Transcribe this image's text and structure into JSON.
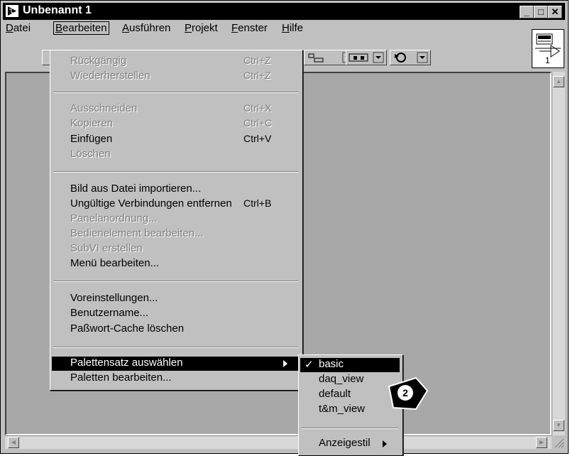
{
  "window": {
    "title": "Unbenannt 1"
  },
  "window_buttons": {
    "minimize": "_",
    "maximize": "□",
    "close": "✕"
  },
  "menubar": {
    "items": [
      {
        "label": "Datei",
        "u": "D",
        "rest": "atei"
      },
      {
        "label": "Bearbeiten",
        "u": "B",
        "rest": "earbeiten"
      },
      {
        "label": "Ausführen",
        "u": "A",
        "rest": "usführen"
      },
      {
        "label": "Projekt",
        "u": "P",
        "rest": "rojekt"
      },
      {
        "label": "Fenster",
        "u": "F",
        "rest": "enster"
      },
      {
        "label": "Hilfe",
        "u": "H",
        "rest": "ilfe"
      }
    ]
  },
  "vi_icon": {
    "connector_number": "1"
  },
  "edit_menu": {
    "items": [
      {
        "label": "Rückgängig",
        "shortcut": "Ctrl+Z",
        "enabled": false
      },
      {
        "label": "Wiederherstellen",
        "shortcut": "Ctrl+Z",
        "enabled": false
      },
      {
        "label": "Ausschneiden",
        "shortcut": "Ctrl+X",
        "enabled": false
      },
      {
        "label": "Kopieren",
        "shortcut": "Ctrl+C",
        "enabled": false
      },
      {
        "label": "Einfügen",
        "shortcut": "Ctrl+V",
        "enabled": true
      },
      {
        "label": "Löschen",
        "shortcut": "",
        "enabled": false
      },
      {
        "label": "Bild aus Datei importieren...",
        "shortcut": "",
        "enabled": true
      },
      {
        "label": "Ungültige Verbindungen entfernen",
        "shortcut": "Ctrl+B",
        "enabled": true
      },
      {
        "label": "Panelanordnung...",
        "shortcut": "",
        "enabled": false
      },
      {
        "label": "Bedienelement bearbeiten...",
        "shortcut": "",
        "enabled": false
      },
      {
        "label": "SubVI erstellen",
        "shortcut": "",
        "enabled": false
      },
      {
        "label": "Menü bearbeiten...",
        "shortcut": "",
        "enabled": true
      },
      {
        "label": "Voreinstellungen...",
        "shortcut": "",
        "enabled": true
      },
      {
        "label": "Benutzername...",
        "shortcut": "",
        "enabled": true
      },
      {
        "label": "Paßwort-Cache löschen",
        "shortcut": "",
        "enabled": true
      },
      {
        "label": "Palettensatz auswählen",
        "shortcut": "",
        "enabled": true,
        "selected": true
      },
      {
        "label": "Paletten bearbeiten...",
        "shortcut": "",
        "enabled": true
      }
    ]
  },
  "palette_submenu": {
    "checkmark": "✓",
    "items": [
      {
        "label": "basic",
        "checked": true
      },
      {
        "label": "daq_view",
        "checked": false
      },
      {
        "label": "default",
        "checked": false
      },
      {
        "label": "t&m_view",
        "checked": false
      },
      {
        "label": "Anzeigestil",
        "checked": false
      }
    ]
  },
  "callout": {
    "number": "2"
  }
}
